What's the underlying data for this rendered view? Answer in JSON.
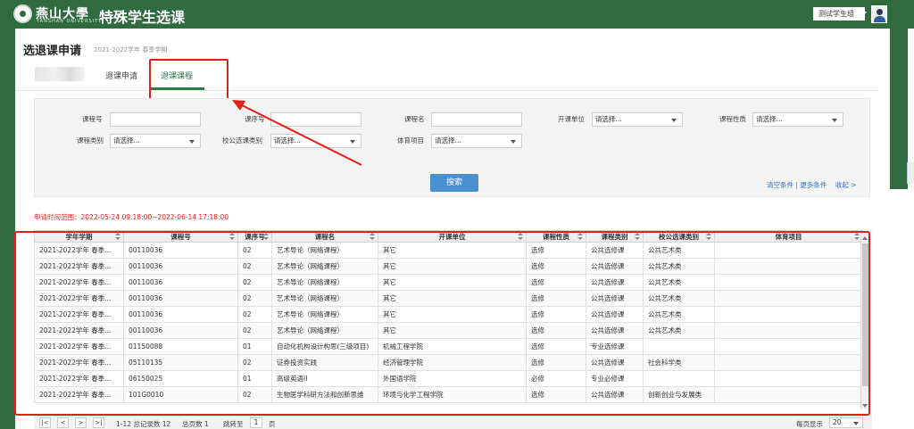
{
  "header": {
    "brand_cn": "燕山大學",
    "brand_en": "YANSHAN UNIVERSITY",
    "app_title": "特殊学生选课",
    "user_name": "测试学生组"
  },
  "page": {
    "title": "选退课申请",
    "subtitle": "2021-2022学年 春季学期"
  },
  "tabs": [
    {
      "label": "退课申请"
    },
    {
      "label": "退课课程"
    }
  ],
  "form": {
    "fields": [
      {
        "label": "课程号",
        "type": "input",
        "value": ""
      },
      {
        "label": "课序号",
        "type": "input",
        "value": ""
      },
      {
        "label": "课程名",
        "type": "input",
        "value": ""
      },
      {
        "label": "开课单位",
        "type": "select",
        "value": "请选择..."
      },
      {
        "label": "课程性质",
        "type": "select",
        "value": "请选择..."
      },
      {
        "label": "课程类别",
        "type": "select",
        "value": "请选择..."
      },
      {
        "label": "校公选课类别",
        "type": "select",
        "value": "请选择..."
      },
      {
        "label": "体育项目",
        "type": "select",
        "value": "请选择..."
      }
    ],
    "search_label": "搜索",
    "clear_label": "清空条件",
    "separator": "|",
    "more_label": "更多条件",
    "collapse_label": "收起 >"
  },
  "time_range": "申请时间范围：2022-05-24 09:18:00~2022-06-14 17:18:00",
  "table": {
    "columns": [
      "学年学期",
      "课程号",
      "课序号",
      "课程名",
      "开课单位",
      "课程性质",
      "课程类别",
      "校公选课类别",
      "体育项目"
    ],
    "rows": [
      [
        "2021-2022学年 春季...",
        "00110036",
        "02",
        "艺术导论（网络课程）",
        "其它",
        "选修",
        "公共选修课",
        "公共艺术类",
        ""
      ],
      [
        "2021-2022学年 春季...",
        "00110036",
        "02",
        "艺术导论（网络课程）",
        "其它",
        "选修",
        "公共选修课",
        "公共艺术类",
        ""
      ],
      [
        "2021-2022学年 春季...",
        "00110036",
        "02",
        "艺术导论（网络课程）",
        "其它",
        "选修",
        "公共选修课",
        "公共艺术类",
        ""
      ],
      [
        "2021-2022学年 春季...",
        "00110036",
        "02",
        "艺术导论（网络课程）",
        "其它",
        "选修",
        "公共选修课",
        "公共艺术类",
        ""
      ],
      [
        "2021-2022学年 春季...",
        "00110036",
        "02",
        "艺术导论（网络课程）",
        "其它",
        "选修",
        "公共选修课",
        "公共艺术类",
        ""
      ],
      [
        "2021-2022学年 春季...",
        "00110036",
        "02",
        "艺术导论（网络课程）",
        "其它",
        "选修",
        "公共选修课",
        "公共艺术类",
        ""
      ],
      [
        "2021-2022学年 春季...",
        "01150088",
        "01",
        "自动化机构设计构思(三级项目)",
        "机械工程学院",
        "选修",
        "专业选修课",
        "",
        ""
      ],
      [
        "2021-2022学年 春季...",
        "05110135",
        "02",
        "证券投资实践",
        "经济管理学院",
        "选修",
        "公共选修课",
        "社会科学类",
        ""
      ],
      [
        "2021-2022学年 春季...",
        "06150025",
        "01",
        "高级英语II",
        "外国语学院",
        "必修",
        "专业必修课",
        "",
        ""
      ],
      [
        "2021-2022学年 春季...",
        "101G0010",
        "02",
        "生物医学科研方法和创新思维",
        "环境与化学工程学院",
        "选修",
        "公共选修课",
        "创新创业与发展类",
        ""
      ]
    ]
  },
  "pager": {
    "first": "|<",
    "prev": "<",
    "next": ">",
    "last": ">|",
    "summary": "1-12 总记录数 12",
    "total_pages": "总页数 1",
    "jump_label": "跳转至",
    "page_value": "1",
    "page_unit": "页",
    "page_size_label": "每页显示",
    "page_size": "20"
  },
  "colors": {
    "brand_green": "#2f6b3f",
    "tab_active": "#2f7a44",
    "highlight_red": "#e0201b",
    "search_button": "#4a8fd0",
    "link_blue": "#2f72c4"
  }
}
